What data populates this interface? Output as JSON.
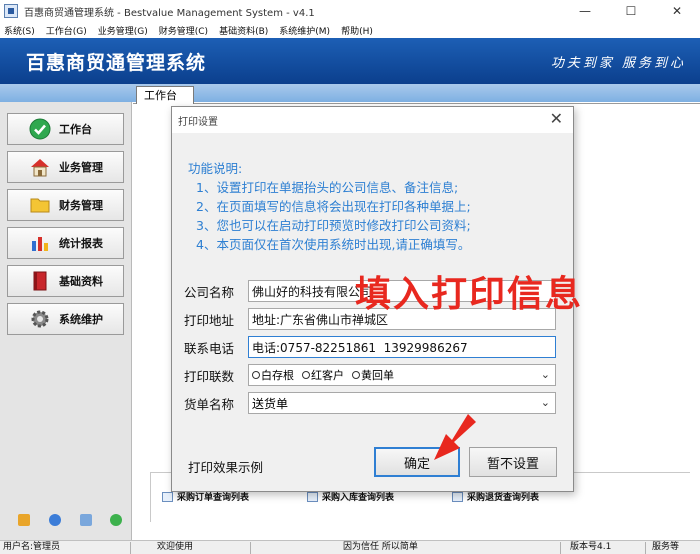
{
  "window": {
    "title": "百惠商贸通管理系统 - Bestvalue Management System - v4.1",
    "minimize": "—",
    "maximize": "☐",
    "close": "✕"
  },
  "menu": [
    "系统(S)",
    "工作台(G)",
    "业务管理(G)",
    "财务管理(C)",
    "基础资料(B)",
    "系统维护(M)",
    "帮助(H)"
  ],
  "banner": {
    "title": "百惠商贸通管理系统",
    "slogan": "功夫到家 服务到心"
  },
  "nav": [
    {
      "label": "工作台",
      "icon": "check-circle-icon"
    },
    {
      "label": "业务管理",
      "icon": "house-icon"
    },
    {
      "label": "财务管理",
      "icon": "folder-icon"
    },
    {
      "label": "统计报表",
      "icon": "bar-chart-icon"
    },
    {
      "label": "基础资料",
      "icon": "book-icon"
    },
    {
      "label": "系统维护",
      "icon": "gear-icon"
    }
  ],
  "tab": {
    "workbench": "工作台"
  },
  "reports": [
    "采购订单查询列表",
    "采购入库查询列表",
    "采购退货查询列表"
  ],
  "status": {
    "user": "用户名:管理员",
    "welcome": "欢迎使用",
    "motto": "因为信任 所以简单",
    "version": "版本号4.1",
    "service": "服务等"
  },
  "dialog": {
    "title": "打印设置",
    "close": "✕",
    "desc_title": "功能说明:",
    "desc_lines": [
      "1、设置打印在单据抬头的公司信息、备注信息;",
      "2、在页面填写的信息将会出现在打印各种单据上;",
      "3、您也可以在启动打印预览时修改打印公司资料;",
      "4、本页面仅在首次使用系统时出现,请正确填写。"
    ],
    "fields": {
      "company_label": "公司名称",
      "company_value": "佛山好的科技有限公司",
      "address_label": "打印地址",
      "address_value": "地址:广东省佛山市禅城区",
      "phone_label": "联系电话",
      "phone_value": "电话:0757-82251861  13929986267",
      "copies_label": "打印联数",
      "copies_options": [
        "白存根",
        "红客户",
        "黄回单"
      ],
      "docname_label": "货单名称",
      "docname_value": "送货单"
    },
    "print_example": "打印效果示例",
    "ok": "确定",
    "cancel": "暂不设置"
  },
  "overlay": "填入打印信息",
  "colors": {
    "banner": "#0b3f8d",
    "desc_text": "#2d7fd2",
    "overlay_red": "#e8281f",
    "focus_blue": "#2f7fd3"
  }
}
